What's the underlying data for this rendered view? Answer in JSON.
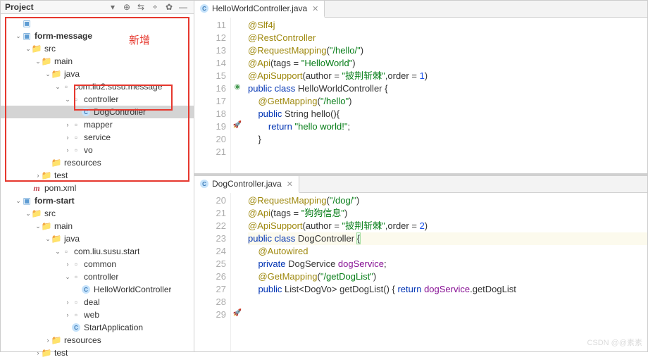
{
  "sidebar": {
    "title": "Project",
    "redLabel": "新增",
    "tree": [
      {
        "indent": 1,
        "exp": "",
        "icon": "module",
        "label": "",
        "gray": true
      },
      {
        "indent": 1,
        "exp": "v",
        "icon": "module",
        "label": "form-message",
        "bold": true
      },
      {
        "indent": 2,
        "exp": "v",
        "icon": "folder",
        "label": "src"
      },
      {
        "indent": 3,
        "exp": "v",
        "icon": "folder",
        "label": "main"
      },
      {
        "indent": 4,
        "exp": "v",
        "icon": "java-folder",
        "label": "java"
      },
      {
        "indent": 5,
        "exp": "v",
        "icon": "pkg",
        "label": "com.liu2.susu.message"
      },
      {
        "indent": 6,
        "exp": "v",
        "icon": "pkg",
        "label": "controller"
      },
      {
        "indent": 7,
        "exp": "",
        "icon": "class",
        "label": "DogController",
        "sel": true
      },
      {
        "indent": 6,
        "exp": ">",
        "icon": "pkg",
        "label": "mapper"
      },
      {
        "indent": 6,
        "exp": ">",
        "icon": "pkg",
        "label": "service"
      },
      {
        "indent": 6,
        "exp": ">",
        "icon": "pkg",
        "label": "vo"
      },
      {
        "indent": 4,
        "exp": "",
        "icon": "folder",
        "label": "resources"
      },
      {
        "indent": 3,
        "exp": ">",
        "icon": "folder",
        "label": "test"
      },
      {
        "indent": 2,
        "exp": "",
        "icon": "maven",
        "label": "pom.xml"
      },
      {
        "indent": 1,
        "exp": "v",
        "icon": "module",
        "label": "form-start",
        "bold": true
      },
      {
        "indent": 2,
        "exp": "v",
        "icon": "folder",
        "label": "src"
      },
      {
        "indent": 3,
        "exp": "v",
        "icon": "folder",
        "label": "main"
      },
      {
        "indent": 4,
        "exp": "v",
        "icon": "java-folder",
        "label": "java"
      },
      {
        "indent": 5,
        "exp": "v",
        "icon": "pkg",
        "label": "com.liu.susu.start"
      },
      {
        "indent": 6,
        "exp": ">",
        "icon": "pkg",
        "label": "common"
      },
      {
        "indent": 6,
        "exp": "v",
        "icon": "pkg",
        "label": "controller"
      },
      {
        "indent": 7,
        "exp": "",
        "icon": "class",
        "label": "HelloWorldController"
      },
      {
        "indent": 6,
        "exp": ">",
        "icon": "pkg",
        "label": "deal"
      },
      {
        "indent": 6,
        "exp": ">",
        "icon": "pkg",
        "label": "web"
      },
      {
        "indent": 6,
        "exp": "",
        "icon": "class",
        "label": "StartApplication"
      },
      {
        "indent": 4,
        "exp": ">",
        "icon": "folder",
        "label": "resources"
      },
      {
        "indent": 3,
        "exp": ">",
        "icon": "folder",
        "label": "test"
      }
    ]
  },
  "editor1": {
    "tab": "HelloWorldController.java",
    "startLine": 11,
    "lines": [
      {
        "n": 11,
        "t": "@Slf4j",
        "cls": "ann"
      },
      {
        "n": 12,
        "t": "@RestController",
        "cls": "ann"
      },
      {
        "n": 13,
        "html": "<span class='ann'>@RequestMapping</span>(<span class='str'>\"/hello/\"</span>)"
      },
      {
        "n": 14,
        "html": "<span class='ann'>@Api</span>(tags = <span class='str'>\"HelloWorld\"</span>)"
      },
      {
        "n": 15,
        "html": "<span class='ann'>@ApiSupport</span>(author = <span class='str'>\"披荆斩棘\"</span>,order = <span class='num'>1</span>)"
      },
      {
        "n": 16,
        "gi": "green",
        "html": "<span class='kw'>public class</span> HelloWorldController {"
      },
      {
        "n": 17,
        "t": ""
      },
      {
        "n": 18,
        "html": "    <span class='ann'>@GetMapping</span>(<span class='str'>\"/hello\"</span>)"
      },
      {
        "n": 19,
        "gi": "rocket",
        "html": "    <span class='kw'>public</span> String hello(){"
      },
      {
        "n": 20,
        "html": "        <span class='kw'>return</span> <span class='str'>\"hello world!\"</span>;"
      },
      {
        "n": 21,
        "t": "    }"
      }
    ]
  },
  "editor2": {
    "tab": "DogController.java",
    "lines": [
      {
        "n": 20,
        "html": "<span class='ann'>@RequestMapping</span>(<span class='str'>\"/dog/\"</span>)"
      },
      {
        "n": 21,
        "html": "<span class='ann'>@Api</span>(tags = <span class='str'>\"狗狗信息\"</span>)"
      },
      {
        "n": 22,
        "html": "<span class='ann'>@ApiSupport</span>(author = <span class='str'>\"披荆斩棘\"</span>,order = <span class='num'>2</span>)"
      },
      {
        "n": 23,
        "cursor": true,
        "html": "<span class='kw'>public class</span> DogController <span class='bracket-hl'>{</span><span class='caret'></span>"
      },
      {
        "n": 24,
        "t": ""
      },
      {
        "n": 25,
        "html": "    <span class='ann'>@Autowired</span>"
      },
      {
        "n": 26,
        "html": "    <span class='kw'>private</span> DogService <span class='field'>dogService</span>;"
      },
      {
        "n": 27,
        "t": ""
      },
      {
        "n": 28,
        "html": "    <span class='ann'>@GetMapping</span>(<span class='str'>\"/getDogList\"</span>)"
      },
      {
        "n": 29,
        "gi": "rocket",
        "html": "    <span class='kw'>public</span> List&lt;DogVo&gt; getDogList() { <span class='kw'>return</span> <span class='field'>dogService</span>.getDogList"
      }
    ]
  },
  "watermark": "CSDN @@素素"
}
